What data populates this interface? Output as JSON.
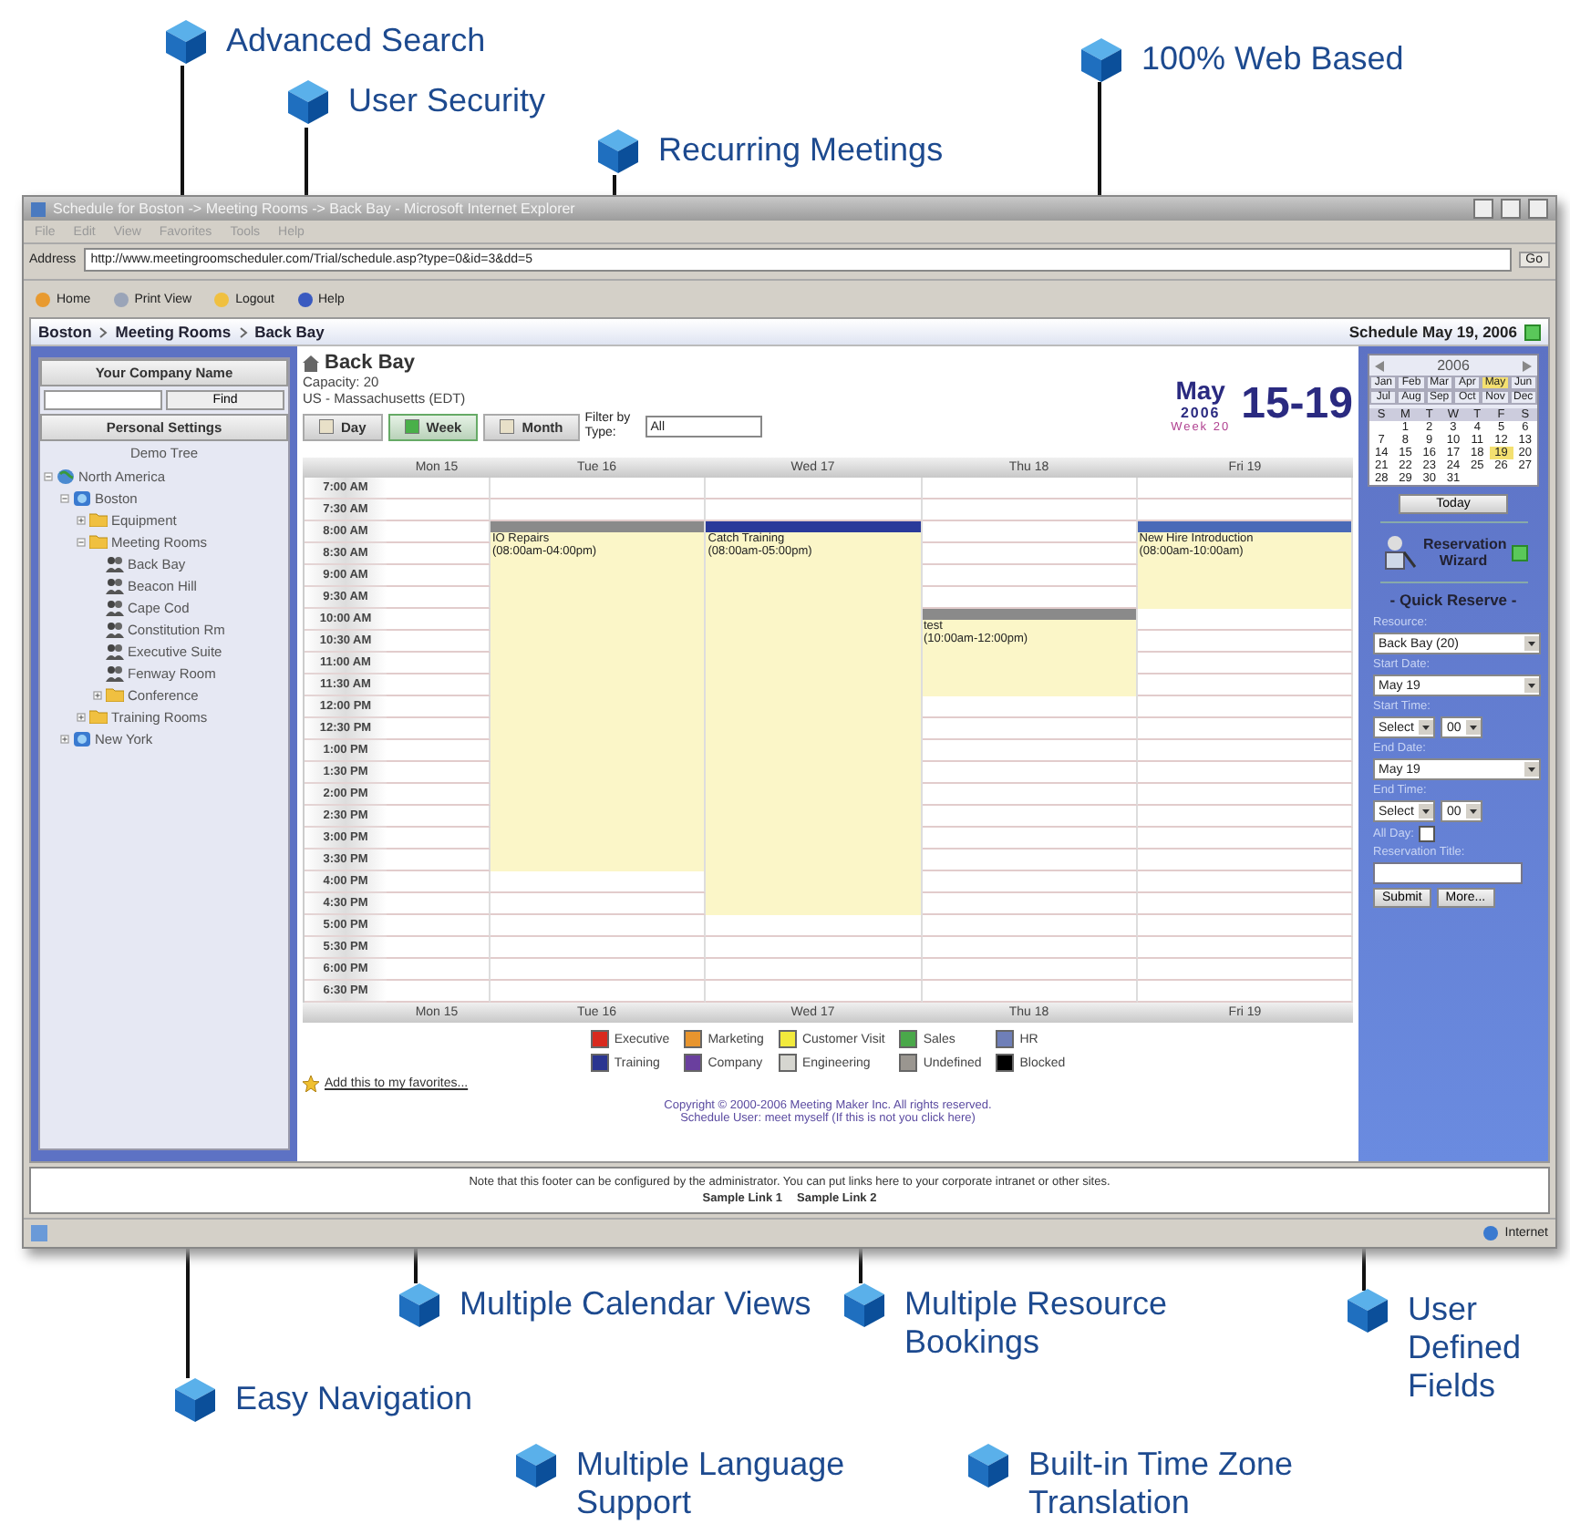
{
  "callouts": [
    {
      "text": "Advanced Search"
    },
    {
      "text": "User Security"
    },
    {
      "text": "Recurring Meetings"
    },
    {
      "text": "100% Web Based"
    },
    {
      "text": "Multiple Calendar Views"
    },
    {
      "text": "Multiple Resource Bookings"
    },
    {
      "text": "User Defined Fields"
    },
    {
      "text": "Easy Navigation"
    },
    {
      "text": "Multiple Language Support"
    },
    {
      "text": "Built-in Time Zone Translation"
    }
  ],
  "window": {
    "title": "Schedule for Boston -> Meeting Rooms -> Back Bay - Microsoft Internet Explorer",
    "menu": [
      "File",
      "Edit",
      "View",
      "Favorites",
      "Tools",
      "Help"
    ],
    "address_label": "Address",
    "url": "http://www.meetingroomscheduler.com/Trial/schedule.asp?type=0&id=3&dd=5",
    "go": "Go"
  },
  "toolbar": [
    "Home",
    "Print View",
    "Logout",
    "Help"
  ],
  "breadcrumb": [
    "Boston",
    "Meeting Rooms",
    "Back Bay"
  ],
  "schedule_date": "Schedule May 19, 2006",
  "sidebar": {
    "company": "Your Company Name",
    "find_button": "Find",
    "settings": "Personal Settings",
    "tree_title": "Demo Tree",
    "tree": [
      {
        "label": "North America",
        "kind": "region",
        "expanded": true,
        "children": [
          {
            "label": "Boston",
            "kind": "city",
            "expanded": true,
            "children": [
              {
                "label": "Equipment",
                "kind": "folder",
                "expanded": false
              },
              {
                "label": "Meeting Rooms",
                "kind": "folder",
                "expanded": true,
                "children": [
                  {
                    "label": "Back Bay",
                    "kind": "room"
                  },
                  {
                    "label": "Beacon Hill",
                    "kind": "room"
                  },
                  {
                    "label": "Cape Cod",
                    "kind": "room"
                  },
                  {
                    "label": "Constitution Rm",
                    "kind": "room"
                  },
                  {
                    "label": "Executive Suite",
                    "kind": "room"
                  },
                  {
                    "label": "Fenway Room",
                    "kind": "room"
                  },
                  {
                    "label": "Conference",
                    "kind": "folder",
                    "expanded": false
                  }
                ]
              },
              {
                "label": "Training Rooms",
                "kind": "folder",
                "expanded": false
              }
            ]
          },
          {
            "label": "New York",
            "kind": "city",
            "expanded": false
          }
        ]
      }
    ]
  },
  "room": {
    "name": "Back Bay",
    "capacity": "Capacity: 20",
    "timezone": "US - Massachusetts (EDT)"
  },
  "views": [
    {
      "label": "Day",
      "selected": false
    },
    {
      "label": "Week",
      "selected": true
    },
    {
      "label": "Month",
      "selected": false
    }
  ],
  "filter": {
    "label": "Filter by Type:",
    "value": "All"
  },
  "period": {
    "month": "May",
    "year": "2006",
    "week": "Week 20",
    "range": "15-19"
  },
  "days_top": [
    "Mon 15",
    "Tue 16",
    "Wed 17",
    "Thu 18",
    "Fri 19"
  ],
  "days_bottom": [
    "Mon 15",
    "Tue 16",
    "Wed 17",
    "Thu 18",
    "Fri 19"
  ],
  "times": [
    "7:00 AM",
    "7:30 AM",
    "8:00 AM",
    "8:30 AM",
    "9:00 AM",
    "9:30 AM",
    "10:00 AM",
    "10:30 AM",
    "11:00 AM",
    "11:30 AM",
    "12:00 PM",
    "12:30 PM",
    "1:00 PM",
    "1:30 PM",
    "2:00 PM",
    "2:30 PM",
    "3:00 PM",
    "3:30 PM",
    "4:00 PM",
    "4:30 PM",
    "5:00 PM",
    "5:30 PM",
    "6:00 PM",
    "6:30 PM"
  ],
  "events": [
    {
      "title": "IO Repairs",
      "time": "(08:00am-04:00pm)",
      "color": "#8a8a8a"
    },
    {
      "title": "Catch Training",
      "time": "(08:00am-05:00pm)",
      "color": "#2a3a9a"
    },
    {
      "title": "test",
      "time": "(10:00am-12:00pm)",
      "color": "#8a8a8a"
    },
    {
      "title": "New Hire Introduction",
      "time": "(08:00am-10:00am)",
      "color": "#4a6ab8"
    }
  ],
  "legend": [
    {
      "label": "Executive",
      "color": "#d82a1e"
    },
    {
      "label": "Marketing",
      "color": "#e8952e"
    },
    {
      "label": "Customer Visit",
      "color": "#f2ea3c"
    },
    {
      "label": "Sales",
      "color": "#4aa84a"
    },
    {
      "label": "HR",
      "color": "#6f7fb8"
    },
    {
      "label": "Training",
      "color": "#2a3590"
    },
    {
      "label": "Company",
      "color": "#6a3f9e"
    },
    {
      "label": "Engineering",
      "color": "#d6d6d0"
    },
    {
      "label": "Undefined",
      "color": "#9a9690"
    },
    {
      "label": "Blocked",
      "color": "#000000"
    }
  ],
  "favorites_link": "Add this to my favorites...",
  "copyright": "Copyright © 2000-2006 Meeting Maker Inc. All rights reserved.",
  "user_line": "Schedule User: meet myself (If this is not you click here)",
  "minical": {
    "year": "2006",
    "months": [
      {
        "label": "Jan",
        "selected": false
      },
      {
        "label": "Feb",
        "selected": false
      },
      {
        "label": "Mar",
        "selected": false
      },
      {
        "label": "Apr",
        "selected": false
      },
      {
        "label": "May",
        "selected": true
      },
      {
        "label": "Jun",
        "selected": false
      },
      {
        "label": "Jul",
        "selected": false
      },
      {
        "label": "Aug",
        "selected": false
      },
      {
        "label": "Sep",
        "selected": false
      },
      {
        "label": "Oct",
        "selected": false
      },
      {
        "label": "Nov",
        "selected": false
      },
      {
        "label": "Dec",
        "selected": false
      }
    ],
    "weekdays": [
      "S",
      "M",
      "T",
      "W",
      "T",
      "F",
      "S"
    ],
    "weeks": [
      [
        {
          "d": "1",
          "selected": false
        },
        {
          "d": "2",
          "selected": false
        },
        {
          "d": "3",
          "selected": false
        },
        {
          "d": "4",
          "selected": false
        },
        {
          "d": "5",
          "selected": false
        },
        {
          "d": "6",
          "selected": false
        }
      ],
      [
        {
          "d": "7",
          "selected": false
        },
        {
          "d": "8",
          "selected": false
        },
        {
          "d": "9",
          "selected": false
        },
        {
          "d": "10",
          "selected": false
        },
        {
          "d": "11",
          "selected": false
        },
        {
          "d": "12",
          "selected": false
        },
        {
          "d": "13",
          "selected": false
        }
      ],
      [
        {
          "d": "14",
          "selected": false
        },
        {
          "d": "15",
          "selected": false
        },
        {
          "d": "16",
          "selected": false
        },
        {
          "d": "17",
          "selected": false
        },
        {
          "d": "18",
          "selected": false
        },
        {
          "d": "19",
          "selected": true
        },
        {
          "d": "20",
          "selected": false
        }
      ],
      [
        {
          "d": "21",
          "selected": false
        },
        {
          "d": "22",
          "selected": false
        },
        {
          "d": "23",
          "selected": false
        },
        {
          "d": "24",
          "selected": false
        },
        {
          "d": "25",
          "selected": false
        },
        {
          "d": "26",
          "selected": false
        },
        {
          "d": "27",
          "selected": false
        }
      ],
      [
        {
          "d": "28",
          "selected": false
        },
        {
          "d": "29",
          "selected": false
        },
        {
          "d": "30",
          "selected": false
        },
        {
          "d": "31",
          "selected": false
        }
      ]
    ],
    "today": "Today"
  },
  "wizard": "Reservation Wizard",
  "quick": {
    "title": "- Quick Reserve -",
    "resource_label": "Resource:",
    "resource": "Back Bay (20)",
    "start_date_label": "Start Date:",
    "start_date": "May 19",
    "start_time_label": "Start Time:",
    "start_hour": "Select",
    "start_min": "00",
    "end_date_label": "End Date:",
    "end_date": "May 19",
    "end_time_label": "End Time:",
    "end_hour": "Select",
    "end_min": "00",
    "all_day_label": "All Day:",
    "all_day": false,
    "title_label": "Reservation Title:",
    "submit": "Submit",
    "more": "More..."
  },
  "footer": {
    "note": "Note that this footer can be configured by the administrator. You can put links here to your corporate intranet or other sites.",
    "links": [
      "Sample Link 1",
      "Sample Link 2"
    ]
  },
  "status": "Internet"
}
